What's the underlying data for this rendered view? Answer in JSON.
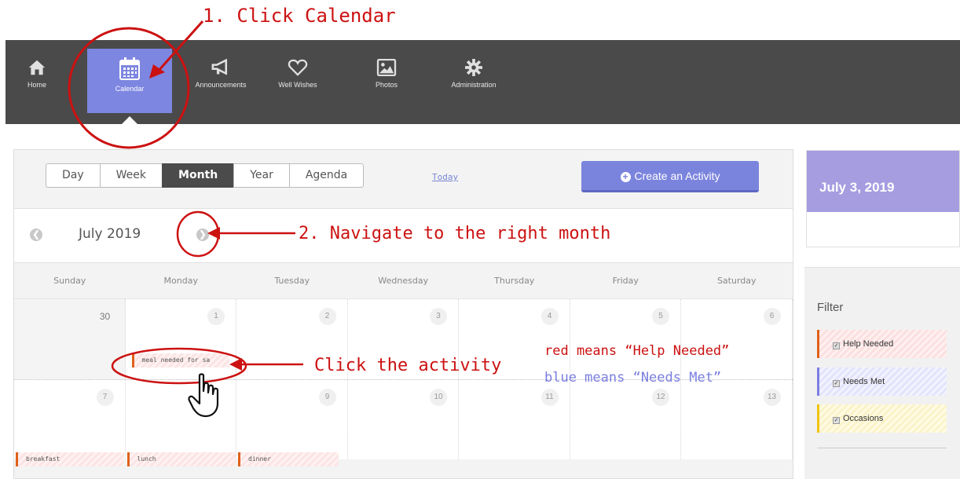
{
  "annotations": {
    "step1": "1. Click Calendar",
    "step2": "2. Navigate to the right month",
    "step3": "Click the activity",
    "legend_red": "red means “Help Needed”",
    "legend_blue": "blue means “Needs Met”"
  },
  "nav": {
    "items": [
      {
        "label": "Home",
        "icon": "home-icon"
      },
      {
        "label": "Calendar",
        "icon": "calendar-icon",
        "active": true
      },
      {
        "label": "Announcements",
        "icon": "megaphone-icon"
      },
      {
        "label": "Well Wishes",
        "icon": "heart-icon"
      },
      {
        "label": "Photos",
        "icon": "photo-icon"
      },
      {
        "label": "Administration",
        "icon": "gear-icon"
      }
    ]
  },
  "toolbar": {
    "views": [
      "Day",
      "Week",
      "Month",
      "Year",
      "Agenda"
    ],
    "active_view": "Month",
    "today": "Today",
    "create": "Create an Activity"
  },
  "calendar": {
    "month_label": "July 2019",
    "weekdays": [
      "Sunday",
      "Monday",
      "Tuesday",
      "Wednesday",
      "Thursday",
      "Friday",
      "Saturday"
    ],
    "weeks": [
      [
        "30",
        "1",
        "2",
        "3",
        "4",
        "5",
        "6"
      ],
      [
        "7",
        "8",
        "9",
        "10",
        "11",
        "12",
        "13"
      ]
    ],
    "events": {
      "mon1": "meal needed for sa",
      "sun7": "breakfast",
      "mon8": "lunch",
      "tue9": "dinner"
    }
  },
  "sidebar": {
    "selected_date": "July 3, 2019",
    "filter_title": "Filter",
    "filters": [
      "Help Needed",
      "Needs Met",
      "Occasions"
    ]
  },
  "colors": {
    "accent": "#7b84dd",
    "help_needed": "#e0611a",
    "needs_met": "#7a7ee0",
    "occasions": "#f1c40f",
    "annotation": "#cc1111"
  }
}
